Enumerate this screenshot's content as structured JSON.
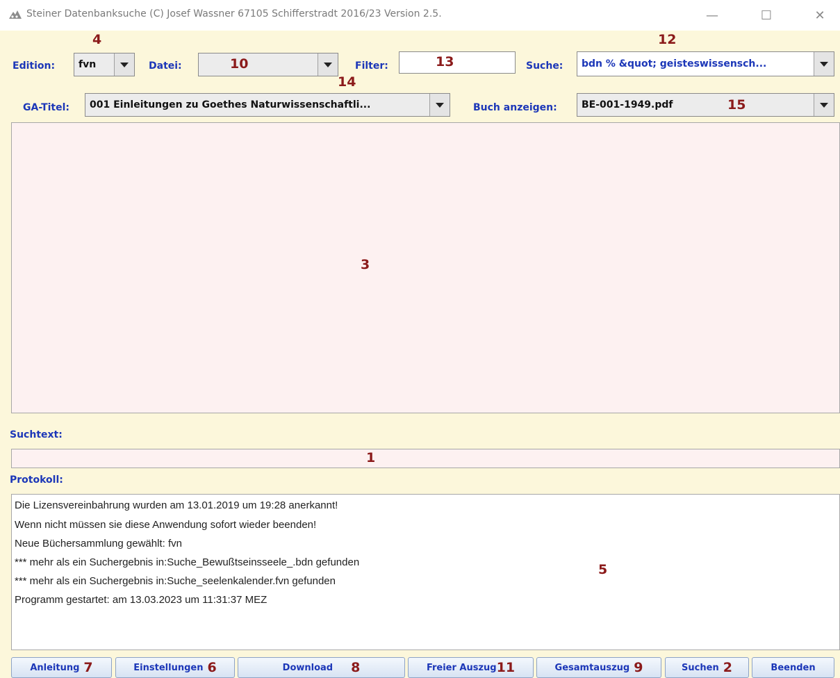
{
  "window": {
    "title": "Steiner Datenbanksuche (C) Josef Wassner 67105  Schifferstradt 2016/23 Version 2.5.",
    "minimize_glyph": "—",
    "maximize_glyph": "☐",
    "close_glyph": "✕"
  },
  "toolbar": {
    "edition_label": "Edition:",
    "edition_value": "fvn",
    "datei_label": "Datei:",
    "datei_value": "",
    "filter_label": "Filter:",
    "filter_value": "",
    "suche_label": "Suche:",
    "suche_value": "bdn % &quot; geisteswissensch...",
    "ga_titel_label": "GA-Titel:",
    "ga_titel_value": "001 Einleitungen zu Goethes Naturwissenschaftli...",
    "buch_label": "Buch anzeigen:",
    "buch_value": "BE-001-1949.pdf"
  },
  "annotations": {
    "n1": "1",
    "n2": "2",
    "n3": "3",
    "n4": "4",
    "n5": "5",
    "n6": "6",
    "n7": "7",
    "n8": "8",
    "n9": "9",
    "n10": "10",
    "n11": "11",
    "n12": "12",
    "n13": "13",
    "n14": "14",
    "n15": "15"
  },
  "labels": {
    "suchtext": "Suchtext:",
    "protokoll": "Protokoll:"
  },
  "protokoll": {
    "lines": [
      "Die Lizensvereinbahrung wurden am 13.01.2019 um 19:28 anerkannt!",
      "Wenn nicht müssen sie diese Anwendung sofort wieder beenden!",
      "Neue Büchersammlung gewählt: fvn",
      "*** mehr als ein Suchergebnis in:Suche_Bewußtseinsseele_.bdn gefunden",
      "*** mehr als ein Suchergebnis in:Suche_seelenkalender.fvn gefunden",
      "Programm gestartet: am 13.03.2023 um 11:31:37  MEZ"
    ]
  },
  "buttons": {
    "anleitung": "Anleitung",
    "einstellungen": "Einstellungen",
    "download": "Download",
    "freier_auszug": "Freier Auszug",
    "gesamtauszug": "Gesamtauszug",
    "suchen": "Suchen",
    "beenden": "Beenden"
  },
  "colors": {
    "label_blue": "#1c37b8",
    "annotation_red": "#8b1a1a",
    "client_bg": "#fcf7db",
    "pane_bg": "#fdf1f1"
  }
}
